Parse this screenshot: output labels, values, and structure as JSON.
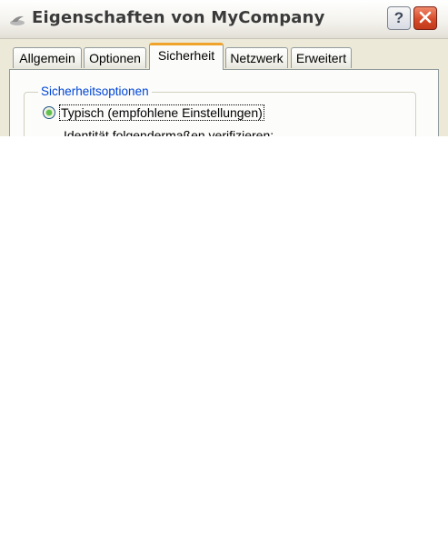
{
  "window": {
    "title": "Eigenschaften von MyCompany",
    "help_label": "?",
    "title_icon": "network-share-icon",
    "close_icon": "close-icon"
  },
  "tabs": [
    {
      "label": "Allgemein",
      "active": false
    },
    {
      "label": "Optionen",
      "active": false
    },
    {
      "label": "Sicherheit",
      "active": true
    },
    {
      "label": "Netzwerk",
      "active": false
    },
    {
      "label": "Erweitert",
      "active": false
    }
  ],
  "security": {
    "group_title": "Sicherheitsoptionen",
    "typical_option": {
      "label": "Typisch (empfohlene Einstellungen)",
      "selected": true
    },
    "identity_text": "Identität folgendermaßen verifizieren:"
  },
  "colors": {
    "window_bg": "#ece9d8",
    "group_title": "#0046d5",
    "active_tab_accent": "#f0a32b",
    "close_button": "#d64b2a"
  }
}
